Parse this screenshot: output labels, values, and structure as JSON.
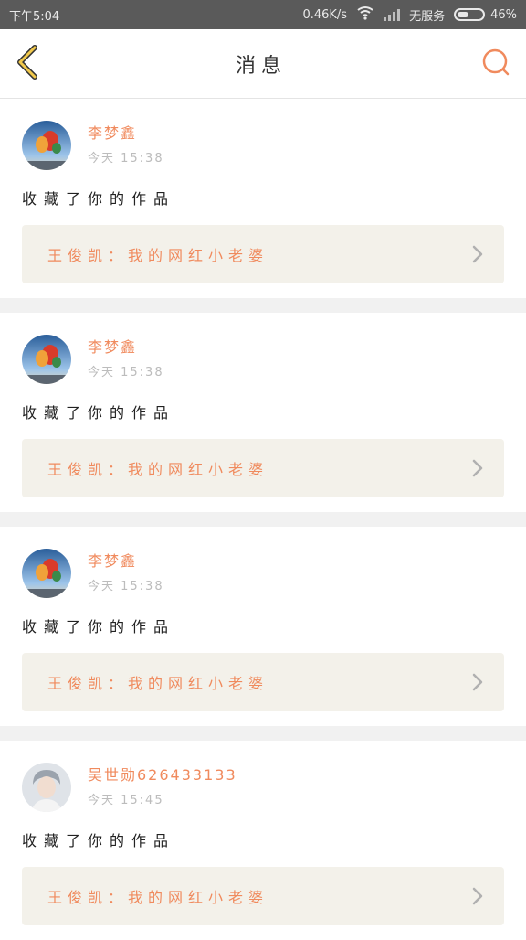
{
  "status_bar": {
    "time": "下午5:04",
    "network_speed": "0.46K/s",
    "carrier": "无服务",
    "battery": "46%",
    "battery_level": 0.46
  },
  "header": {
    "title": "消息",
    "back_icon": "chevron-left-icon",
    "search_icon": "search-icon"
  },
  "notifications": [
    {
      "username": "李梦鑫",
      "timestamp": "今天 15:38",
      "action": "收藏了你的作品",
      "work": "王俊凯：我的网红小老婆",
      "avatar": "balloon"
    },
    {
      "username": "李梦鑫",
      "timestamp": "今天 15:38",
      "action": "收藏了你的作品",
      "work": "王俊凯：我的网红小老婆",
      "avatar": "balloon"
    },
    {
      "username": "李梦鑫",
      "timestamp": "今天 15:38",
      "action": "收藏了你的作品",
      "work": "王俊凯：我的网红小老婆",
      "avatar": "balloon"
    },
    {
      "username": "吴世勋626433133",
      "timestamp": "今天 15:45",
      "action": "收藏了你的作品",
      "work": "王俊凯：我的网红小老婆",
      "avatar": "person"
    }
  ],
  "colors": {
    "accent": "#f08a5d",
    "back_icon": "#f2c94c",
    "link_bg": "#f3f1ea"
  }
}
